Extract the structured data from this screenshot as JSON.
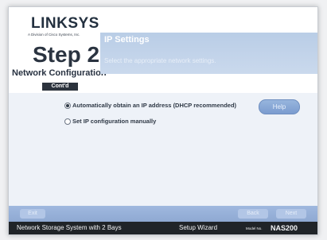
{
  "brand": {
    "name": "LINKSYS",
    "subtitle": "A Division of Cisco Systems, Inc."
  },
  "wizard": {
    "step": "Step 2",
    "section": "Network Configuration",
    "continued": "Cont'd"
  },
  "panel": {
    "title": "IP Settings",
    "description": "Select the appropriate network settings."
  },
  "options": [
    {
      "label": "Automatically obtain an IP address (DHCP recommended)",
      "selected": true
    },
    {
      "label": "Set IP configuration manually",
      "selected": false
    }
  ],
  "buttons": {
    "help": "Help",
    "exit": "Exit",
    "back": "Back",
    "next": "Next"
  },
  "footer": {
    "product": "Network Storage System with 2 Bays",
    "wizard": "Setup Wizard",
    "model_label": "Model No.",
    "model": "NAS200"
  }
}
